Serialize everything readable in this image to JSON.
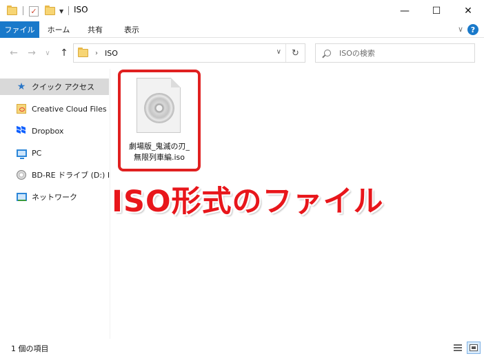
{
  "window": {
    "title": "ISO",
    "minimize_glyph": "—",
    "maximize_glyph": "☐",
    "close_glyph": "✕"
  },
  "ribbon": {
    "tabs": [
      "ファイル",
      "ホーム",
      "共有",
      "表示"
    ],
    "help_glyph": "?",
    "expand_glyph": "∨"
  },
  "navigation": {
    "back_glyph": "←",
    "forward_glyph": "→",
    "history_glyph": "∨",
    "up_glyph": "↑",
    "address_segment": "ISO",
    "breadcrumb_chevron": "›",
    "address_dropdown_glyph": "∨",
    "refresh_glyph": "↻",
    "search_placeholder": "ISOの検索"
  },
  "sidebar": {
    "items": [
      {
        "label": "クイック アクセス",
        "icon": "star-icon",
        "selected": true
      },
      {
        "label": "Creative Cloud Files",
        "icon": "creative-cloud-icon",
        "selected": false
      },
      {
        "label": "Dropbox",
        "icon": "dropbox-icon",
        "selected": false
      },
      {
        "label": "PC",
        "icon": "pc-icon",
        "selected": false
      },
      {
        "label": "BD-RE ドライブ (D:) DV",
        "icon": "disc-drive-icon",
        "selected": false
      },
      {
        "label": "ネットワーク",
        "icon": "network-icon",
        "selected": false
      }
    ]
  },
  "files": [
    {
      "name": "劇場版_鬼滅の刃_\n無限列車編.iso",
      "icon": "disc-image-file-icon"
    }
  ],
  "annotation": {
    "text": "ISO形式のファイル",
    "color": "#e8161b"
  },
  "status": {
    "item_count": "1 個の項目"
  },
  "colors": {
    "accent": "#1979ca",
    "highlight_border": "#e02020"
  }
}
